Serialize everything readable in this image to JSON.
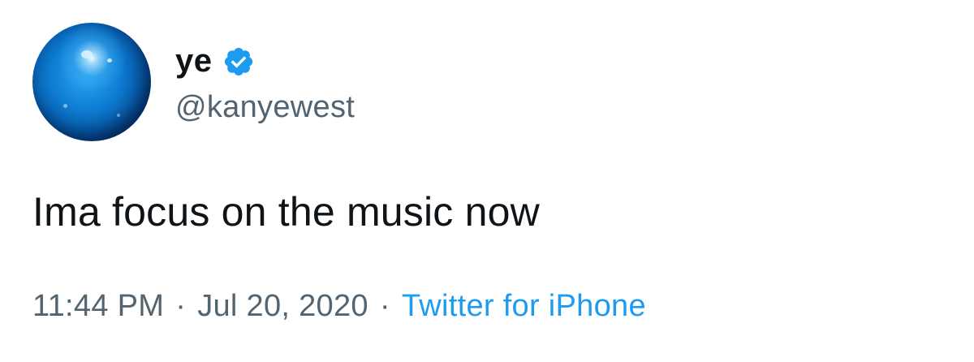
{
  "tweet": {
    "author": {
      "display_name": "ye",
      "handle": "@kanyewest",
      "verified_icon": "verified-badge-icon"
    },
    "text": "Ima focus on the music now",
    "meta": {
      "time": "11:44 PM",
      "separator": "·",
      "date": "Jul 20, 2020",
      "source": "Twitter for iPhone"
    },
    "colors": {
      "verified": "#1d9bf0",
      "link": "#1d9bf0",
      "secondary_text": "#536471",
      "primary_text": "#0f1419"
    }
  }
}
